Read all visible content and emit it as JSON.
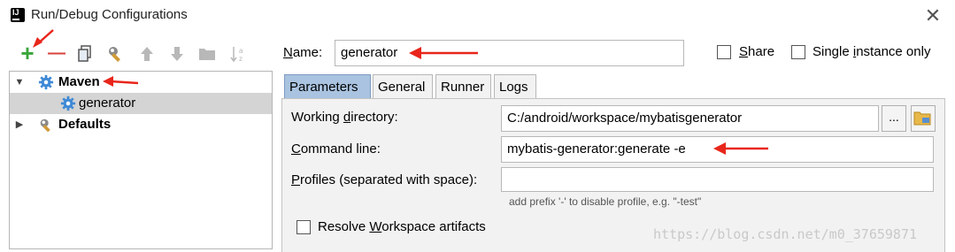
{
  "window": {
    "title": "Run/Debug Configurations",
    "app_icon_text": "IJ",
    "close_glyph": "✕"
  },
  "toolbar": {
    "add": "+",
    "remove": "—",
    "copy": "⧉",
    "edit": "✎",
    "up": "⬆",
    "down": "⬇",
    "folder": "▬",
    "sort": "↓a z"
  },
  "tree": {
    "items": [
      {
        "label": "Maven",
        "expanded": true,
        "bold": true
      },
      {
        "label": "generator",
        "selected": true
      },
      {
        "label": "Defaults",
        "expanded": false,
        "bold": true
      }
    ]
  },
  "form": {
    "name_label": "Name:",
    "name_mnemonic": "N",
    "name_rest": "ame:",
    "name_value": "generator",
    "share_label": "Share",
    "share_mnemonic": "S",
    "share_rest": "hare",
    "single_label_pre": "Single ",
    "single_mnemonic": "i",
    "single_rest": "nstance only",
    "share_checked": false,
    "single_checked": false
  },
  "tabs": [
    "Parameters",
    "General",
    "Runner",
    "Logs"
  ],
  "active_tab": "Parameters",
  "parameters": {
    "working_dir_pre": "Working ",
    "working_dir_mn": "d",
    "working_dir_rest": "irectory:",
    "working_dir_value": "C:/android/workspace/mybatisgenerator",
    "browse_label": "...",
    "command_mn": "C",
    "command_rest": "ommand line:",
    "command_value": "mybatis-generator:generate -e",
    "profiles_mn": "P",
    "profiles_rest": "rofiles (separated with space):",
    "profiles_value": "",
    "profiles_hint": "add prefix '-' to disable profile, e.g. \"-test\"",
    "resolve_pre": "Resolve ",
    "resolve_mn": "W",
    "resolve_rest": "orkspace artifacts",
    "resolve_checked": false
  },
  "watermark": "https://blog.csdn.net/m0_37659871",
  "colors": {
    "accent_red": "#e8261b",
    "tab_active": "#a9c3e0",
    "selection": "#d4d4d4",
    "add_green": "#3aa63a",
    "remove_red": "#d9423b",
    "gear_blue": "#3f8ad6"
  }
}
